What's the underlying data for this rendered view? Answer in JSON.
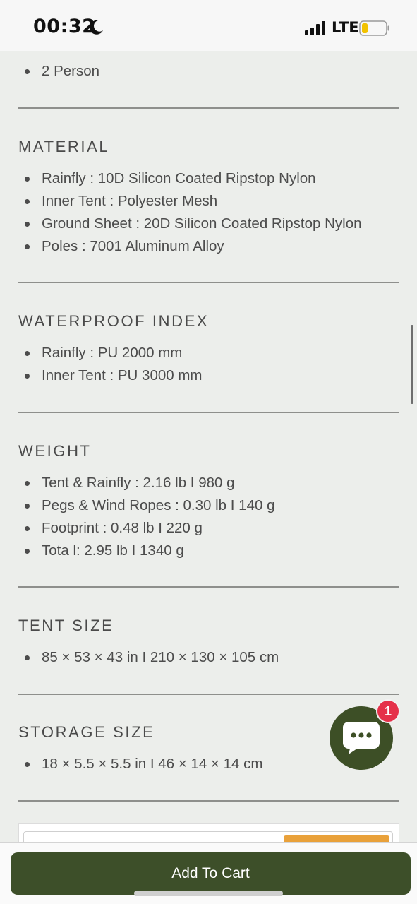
{
  "status_bar": {
    "time": "00:32",
    "network": "LTE"
  },
  "specs": {
    "capacity": {
      "items": [
        "2 Person"
      ]
    },
    "material": {
      "title": "MATERIAL",
      "items": [
        "Rainfly : 10D Silicon Coated Ripstop Nylon",
        "Inner Tent : Polyester Mesh",
        "Ground Sheet : 20D Silicon Coated Ripstop Nylon",
        "Poles : 7001 Aluminum Alloy"
      ]
    },
    "waterproof": {
      "title": "WATERPROOF INDEX",
      "items": [
        "Rainfly : PU 2000 mm",
        "Inner Tent : PU 3000 mm"
      ]
    },
    "weight": {
      "title": "WEIGHT",
      "items": [
        "Tent & Rainfly : 2.16 lb I 980 g",
        "Pegs & Wind Ropes : 0.30 lb I 140 g",
        "Footprint : 0.48 lb I 220 g",
        "Tota l: 2.95 lb I 1340 g"
      ]
    },
    "tent_size": {
      "title": "TENT SIZE",
      "items": [
        "85 × 53 × 43 in I 210 × 130 × 105 cm"
      ]
    },
    "storage_size": {
      "title": "STORAGE SIZE",
      "items": [
        "18 × 5.5 × 5.5 in I 46 × 14 × 14 cm"
      ]
    }
  },
  "chat": {
    "badge_count": "1",
    "icon": "chat-bubble-icon"
  },
  "cart": {
    "button_label": "Add To Cart"
  },
  "colors": {
    "accent": "#3d4f29",
    "badge": "#e5314a",
    "background": "#eceeeb"
  }
}
